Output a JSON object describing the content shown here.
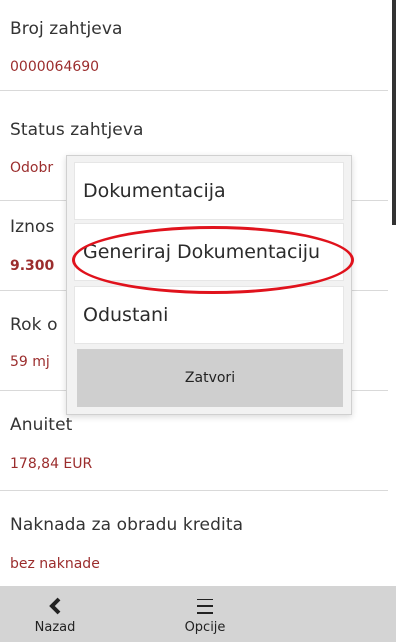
{
  "fields": [
    {
      "label": "Broj zahtjeva",
      "value": "0000064690"
    },
    {
      "label": "Status zahtjeva",
      "value": "Odobr"
    },
    {
      "label": "Iznos",
      "value": "9.300"
    },
    {
      "label": "Rok o",
      "value": "59 mj"
    },
    {
      "label": "Anuitet",
      "value": "178,84 EUR"
    },
    {
      "label": "Naknada za obradu kredita",
      "value": "bez naknade"
    }
  ],
  "popup": {
    "items": [
      "Dokumentacija",
      "Generiraj Dokumentaciju",
      "Odustani"
    ],
    "close_label": "Zatvori",
    "highlight_color": "#e0121c"
  },
  "bottom_bar": {
    "back_label": "Nazad",
    "back_icon": "chevron-left-icon",
    "options_label": "Opcije",
    "options_icon": "hamburger-menu-icon"
  },
  "colors": {
    "value_text": "#9b2d2d",
    "bottom_bar": "#d4d4d4",
    "close_button": "#cfcfcf"
  }
}
